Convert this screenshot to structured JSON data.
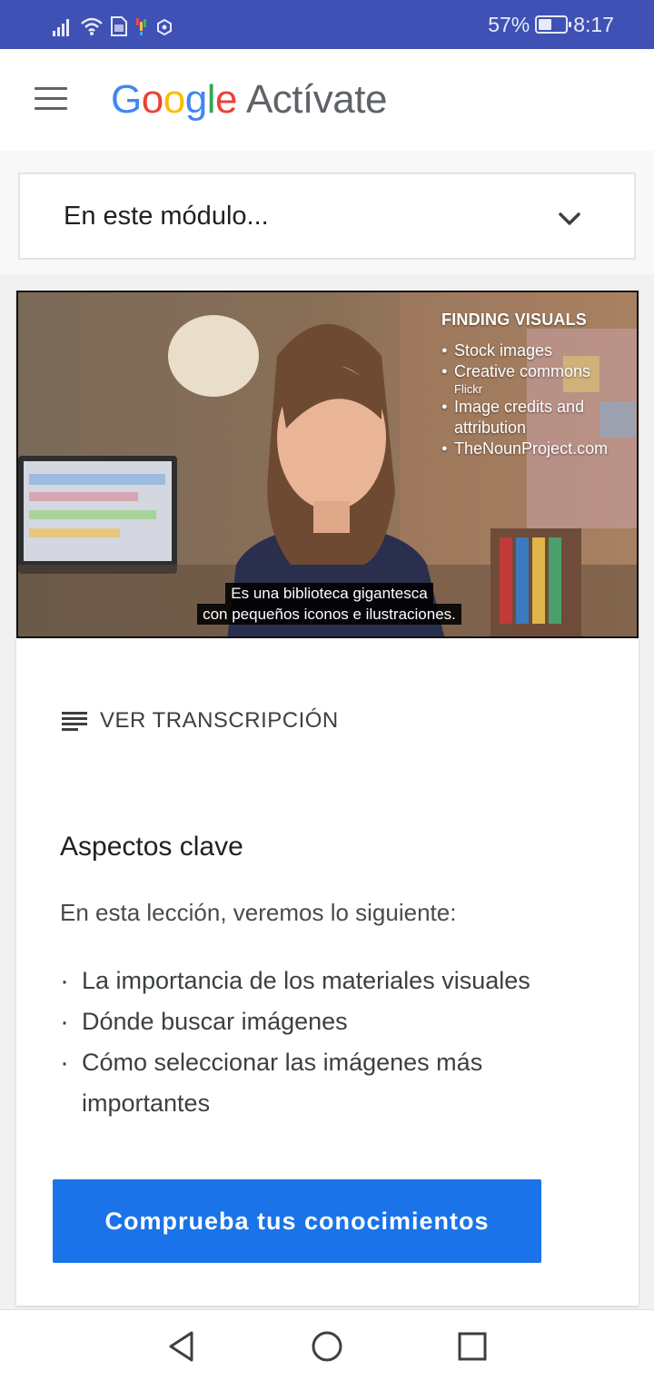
{
  "status_bar": {
    "battery_percent": "57%",
    "battery_level": 0.57,
    "time": "8:17",
    "icons": [
      "signal-icon",
      "wifi-icon",
      "sim-icon",
      "notification-icon",
      "app-icon"
    ]
  },
  "header": {
    "brand_letters": [
      "G",
      "o",
      "o",
      "g",
      "l",
      "e"
    ],
    "product": "Actívate",
    "brand_colors": {
      "blue": "#4285f4",
      "red": "#ea4335",
      "yellow": "#fbbc05",
      "green": "#34a853"
    },
    "menu_icon": "hamburger-menu-icon"
  },
  "module_select": {
    "label": "En este módulo...",
    "icon": "chevron-down-icon"
  },
  "video": {
    "overlay_title": "FINDING VISUALS",
    "overlay_items": [
      {
        "text": "Stock images",
        "sub": ""
      },
      {
        "text": "Creative commons",
        "sub": "Flickr"
      },
      {
        "text": "Image credits and attribution",
        "sub": ""
      },
      {
        "text": "TheNounProject.com",
        "sub": ""
      }
    ],
    "caption_line1": "Es una biblioteca gigantesca",
    "caption_line2": "con pequeños iconos e ilustraciones."
  },
  "transcript": {
    "label": "VER TRANSCRIPCIÓN",
    "icon": "transcript-lines-icon"
  },
  "key_points": {
    "title": "Aspectos clave",
    "intro": "En esta lección, veremos lo siguiente:",
    "bullets": [
      "La importancia de los materiales visuales",
      "Dónde buscar imágenes",
      "Cómo seleccionar las imágenes más importantes"
    ]
  },
  "cta": {
    "label": "Comprueba tus conocimientos",
    "color": "#1a73e8"
  },
  "status_bar_color": "#3f51b5",
  "nav_bar": {
    "icons": [
      "back-icon",
      "home-icon",
      "recents-icon"
    ]
  }
}
